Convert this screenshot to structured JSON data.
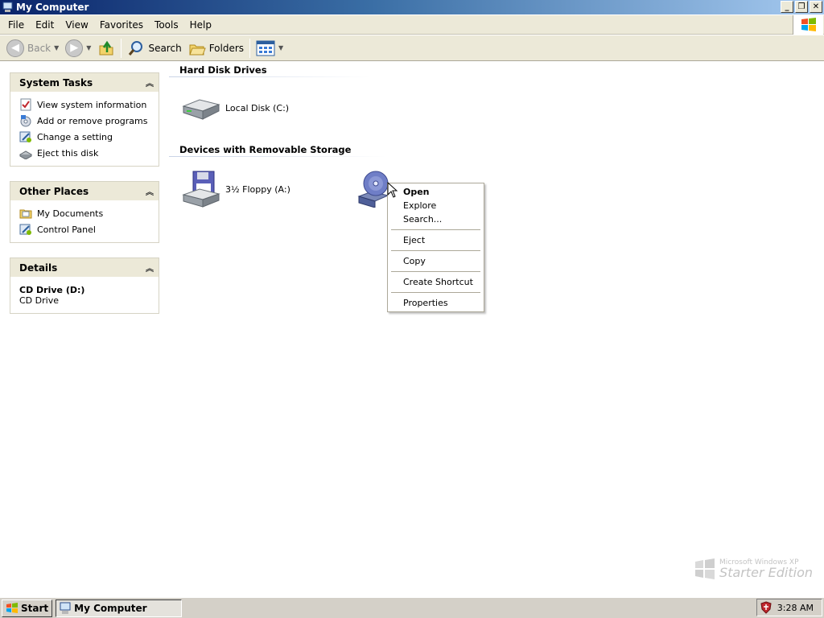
{
  "window": {
    "title": "My Computer",
    "buttons": {
      "minimize": "_",
      "maximize": "❐",
      "close": "✕"
    }
  },
  "menubar": [
    "File",
    "Edit",
    "View",
    "Favorites",
    "Tools",
    "Help"
  ],
  "toolbar": {
    "back": "Back",
    "search": "Search",
    "folders": "Folders"
  },
  "left_pane": {
    "system_tasks": {
      "title": "System Tasks",
      "items": [
        {
          "label": "View system information",
          "icon": "system-info-icon"
        },
        {
          "label": "Add or remove programs",
          "icon": "add-remove-programs-icon"
        },
        {
          "label": "Change a setting",
          "icon": "control-panel-icon"
        },
        {
          "label": "Eject this disk",
          "icon": "eject-disk-icon"
        }
      ]
    },
    "other_places": {
      "title": "Other Places",
      "items": [
        {
          "label": "My Documents",
          "icon": "my-documents-icon"
        },
        {
          "label": "Control Panel",
          "icon": "control-panel-icon"
        }
      ]
    },
    "details": {
      "title": "Details",
      "name": "CD Drive (D:)",
      "type": "CD Drive"
    }
  },
  "main": {
    "hard_disk_section": "Hard Disk Drives",
    "removable_section": "Devices with Removable Storage",
    "drives": {
      "local_disk": "Local Disk (C:)",
      "floppy": "3½ Floppy (A:)"
    }
  },
  "context_menu": {
    "open": "Open",
    "explore": "Explore",
    "search": "Search...",
    "eject": "Eject",
    "copy": "Copy",
    "create_shortcut": "Create Shortcut",
    "properties": "Properties"
  },
  "watermark": {
    "line1": "Microsoft Windows XP",
    "line2": "Starter Edition"
  },
  "taskbar": {
    "start": "Start",
    "task": "My Computer",
    "clock": "3:28 AM"
  },
  "colors": {
    "title_start": "#0a246a",
    "title_end": "#a6caf0",
    "panel_header": "#ece9d8",
    "taskbar": "#d4d0c8"
  }
}
